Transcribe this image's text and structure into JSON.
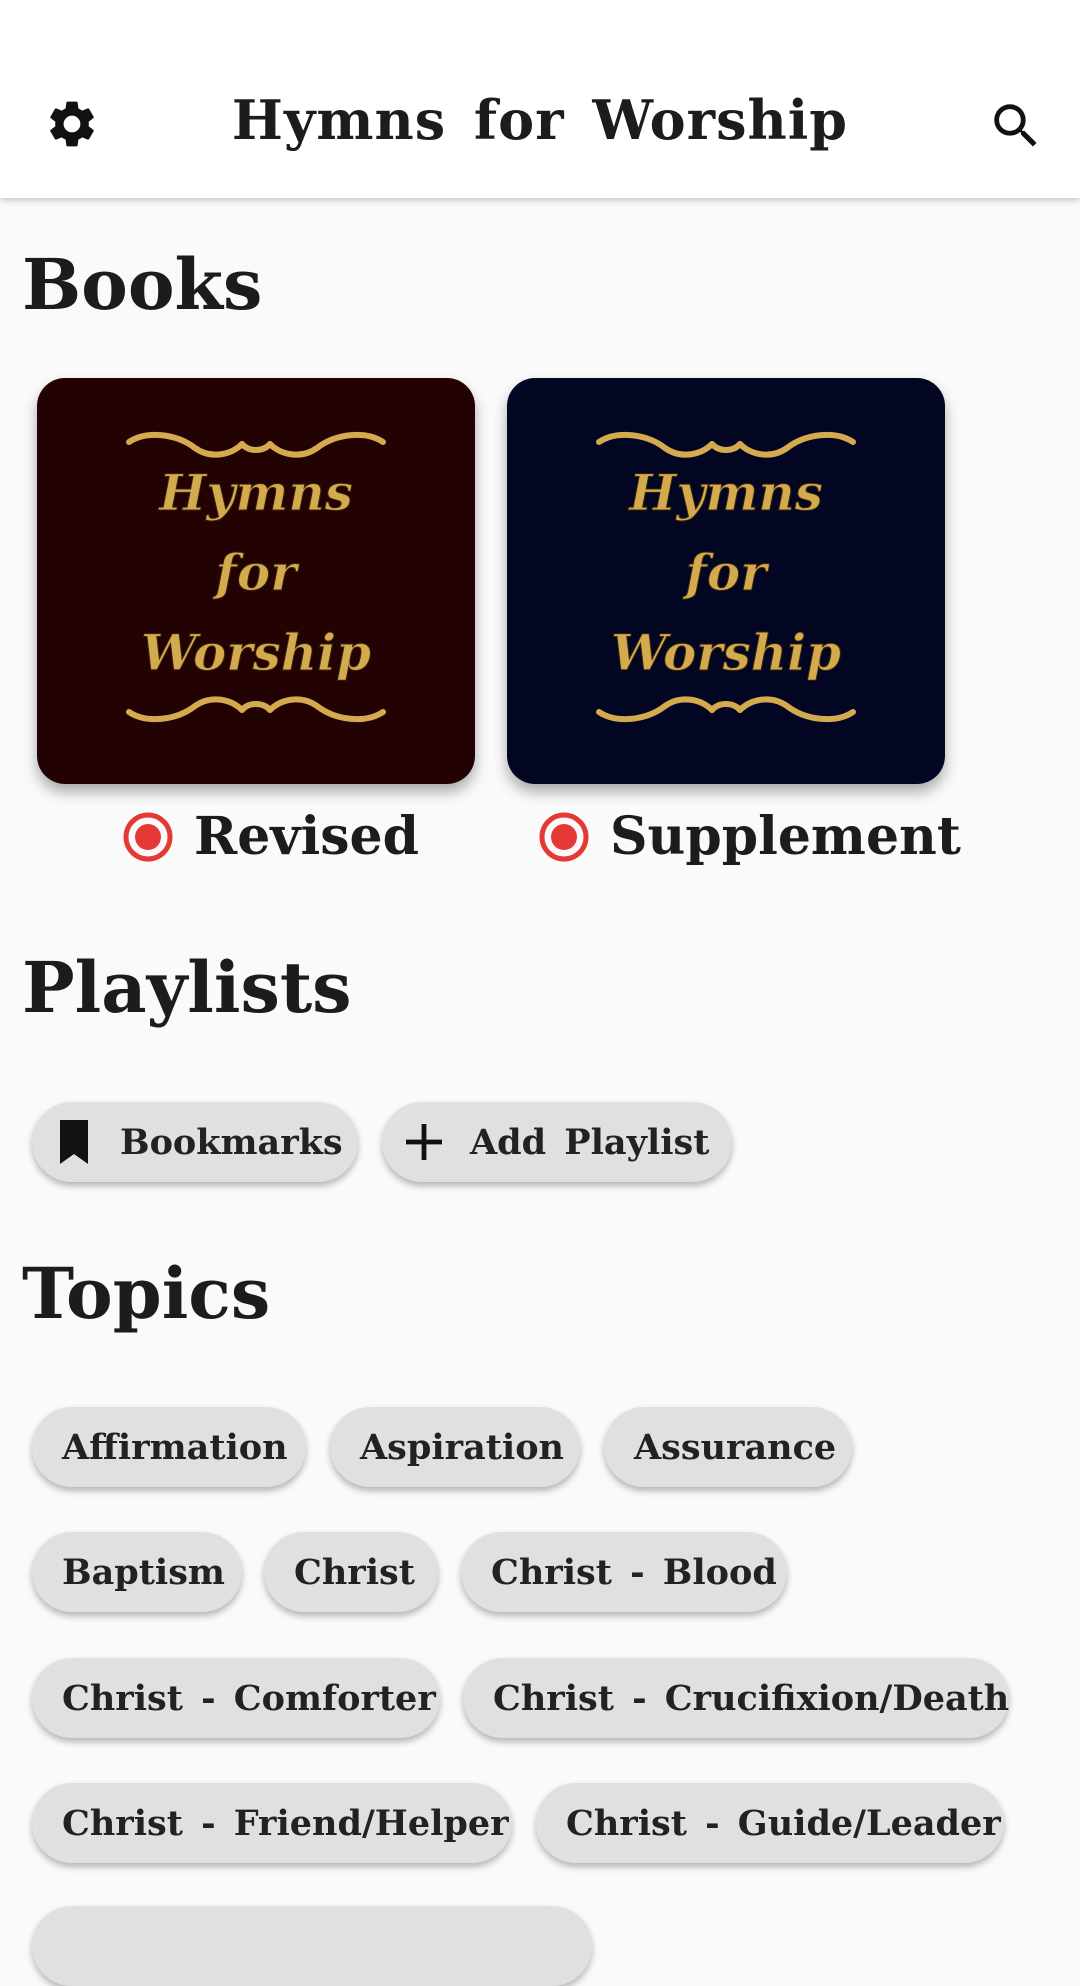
{
  "app_bar": {
    "title": "Hymns for Worship",
    "settings_icon": "gear-icon",
    "search_icon": "search-icon"
  },
  "books": {
    "heading": "Books",
    "items": [
      {
        "cover_lines": [
          "Hymns",
          "for",
          "Worship"
        ],
        "label": "Revised",
        "selected": true,
        "cover_color": "#220202"
      },
      {
        "cover_lines": [
          "Hymns",
          "for",
          "Worship"
        ],
        "label": "Supplement",
        "selected": true,
        "cover_color": "#020623"
      }
    ],
    "radio_color": "#e53935",
    "gold_color": "#d4aa4e"
  },
  "playlists": {
    "heading": "Playlists",
    "items": [
      {
        "label": "Bookmarks",
        "icon": "bookmark-icon"
      },
      {
        "label": "Add Playlist",
        "icon": "plus-icon"
      }
    ]
  },
  "topics": {
    "heading": "Topics",
    "items": [
      "Affirmation",
      "Aspiration",
      "Assurance",
      "Baptism",
      "Christ",
      "Christ - Blood",
      "Christ - Comforter",
      "Christ - Crucifixion/Death",
      "Christ - Friend/Helper",
      "Christ - Guide/Leader"
    ]
  }
}
